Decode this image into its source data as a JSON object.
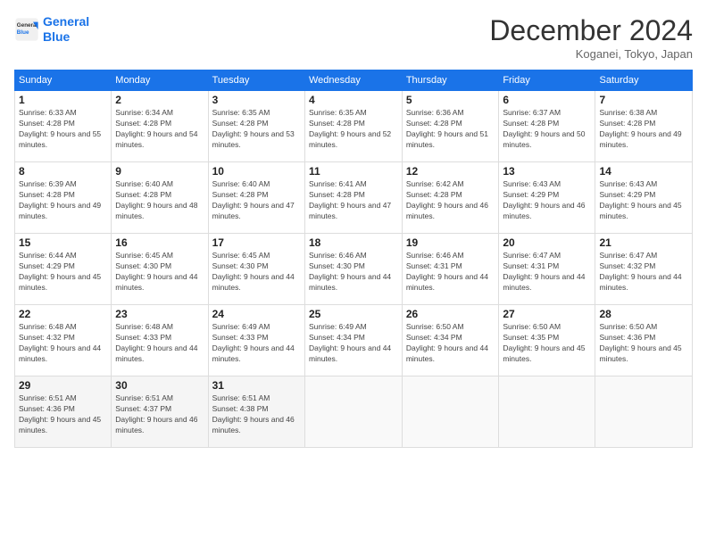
{
  "header": {
    "logo_line1": "General",
    "logo_line2": "Blue",
    "month": "December 2024",
    "location": "Koganei, Tokyo, Japan"
  },
  "weekdays": [
    "Sunday",
    "Monday",
    "Tuesday",
    "Wednesday",
    "Thursday",
    "Friday",
    "Saturday"
  ],
  "weeks": [
    [
      {
        "day": "1",
        "sunrise": "6:33 AM",
        "sunset": "4:28 PM",
        "daylight": "9 hours and 55 minutes."
      },
      {
        "day": "2",
        "sunrise": "6:34 AM",
        "sunset": "4:28 PM",
        "daylight": "9 hours and 54 minutes."
      },
      {
        "day": "3",
        "sunrise": "6:35 AM",
        "sunset": "4:28 PM",
        "daylight": "9 hours and 53 minutes."
      },
      {
        "day": "4",
        "sunrise": "6:35 AM",
        "sunset": "4:28 PM",
        "daylight": "9 hours and 52 minutes."
      },
      {
        "day": "5",
        "sunrise": "6:36 AM",
        "sunset": "4:28 PM",
        "daylight": "9 hours and 51 minutes."
      },
      {
        "day": "6",
        "sunrise": "6:37 AM",
        "sunset": "4:28 PM",
        "daylight": "9 hours and 50 minutes."
      },
      {
        "day": "7",
        "sunrise": "6:38 AM",
        "sunset": "4:28 PM",
        "daylight": "9 hours and 49 minutes."
      }
    ],
    [
      {
        "day": "8",
        "sunrise": "6:39 AM",
        "sunset": "4:28 PM",
        "daylight": "9 hours and 49 minutes."
      },
      {
        "day": "9",
        "sunrise": "6:40 AM",
        "sunset": "4:28 PM",
        "daylight": "9 hours and 48 minutes."
      },
      {
        "day": "10",
        "sunrise": "6:40 AM",
        "sunset": "4:28 PM",
        "daylight": "9 hours and 47 minutes."
      },
      {
        "day": "11",
        "sunrise": "6:41 AM",
        "sunset": "4:28 PM",
        "daylight": "9 hours and 47 minutes."
      },
      {
        "day": "12",
        "sunrise": "6:42 AM",
        "sunset": "4:28 PM",
        "daylight": "9 hours and 46 minutes."
      },
      {
        "day": "13",
        "sunrise": "6:43 AM",
        "sunset": "4:29 PM",
        "daylight": "9 hours and 46 minutes."
      },
      {
        "day": "14",
        "sunrise": "6:43 AM",
        "sunset": "4:29 PM",
        "daylight": "9 hours and 45 minutes."
      }
    ],
    [
      {
        "day": "15",
        "sunrise": "6:44 AM",
        "sunset": "4:29 PM",
        "daylight": "9 hours and 45 minutes."
      },
      {
        "day": "16",
        "sunrise": "6:45 AM",
        "sunset": "4:30 PM",
        "daylight": "9 hours and 44 minutes."
      },
      {
        "day": "17",
        "sunrise": "6:45 AM",
        "sunset": "4:30 PM",
        "daylight": "9 hours and 44 minutes."
      },
      {
        "day": "18",
        "sunrise": "6:46 AM",
        "sunset": "4:30 PM",
        "daylight": "9 hours and 44 minutes."
      },
      {
        "day": "19",
        "sunrise": "6:46 AM",
        "sunset": "4:31 PM",
        "daylight": "9 hours and 44 minutes."
      },
      {
        "day": "20",
        "sunrise": "6:47 AM",
        "sunset": "4:31 PM",
        "daylight": "9 hours and 44 minutes."
      },
      {
        "day": "21",
        "sunrise": "6:47 AM",
        "sunset": "4:32 PM",
        "daylight": "9 hours and 44 minutes."
      }
    ],
    [
      {
        "day": "22",
        "sunrise": "6:48 AM",
        "sunset": "4:32 PM",
        "daylight": "9 hours and 44 minutes."
      },
      {
        "day": "23",
        "sunrise": "6:48 AM",
        "sunset": "4:33 PM",
        "daylight": "9 hours and 44 minutes."
      },
      {
        "day": "24",
        "sunrise": "6:49 AM",
        "sunset": "4:33 PM",
        "daylight": "9 hours and 44 minutes."
      },
      {
        "day": "25",
        "sunrise": "6:49 AM",
        "sunset": "4:34 PM",
        "daylight": "9 hours and 44 minutes."
      },
      {
        "day": "26",
        "sunrise": "6:50 AM",
        "sunset": "4:34 PM",
        "daylight": "9 hours and 44 minutes."
      },
      {
        "day": "27",
        "sunrise": "6:50 AM",
        "sunset": "4:35 PM",
        "daylight": "9 hours and 45 minutes."
      },
      {
        "day": "28",
        "sunrise": "6:50 AM",
        "sunset": "4:36 PM",
        "daylight": "9 hours and 45 minutes."
      }
    ],
    [
      {
        "day": "29",
        "sunrise": "6:51 AM",
        "sunset": "4:36 PM",
        "daylight": "9 hours and 45 minutes."
      },
      {
        "day": "30",
        "sunrise": "6:51 AM",
        "sunset": "4:37 PM",
        "daylight": "9 hours and 46 minutes."
      },
      {
        "day": "31",
        "sunrise": "6:51 AM",
        "sunset": "4:38 PM",
        "daylight": "9 hours and 46 minutes."
      },
      null,
      null,
      null,
      null
    ]
  ],
  "labels": {
    "sunrise": "Sunrise:",
    "sunset": "Sunset:",
    "daylight": "Daylight:"
  }
}
